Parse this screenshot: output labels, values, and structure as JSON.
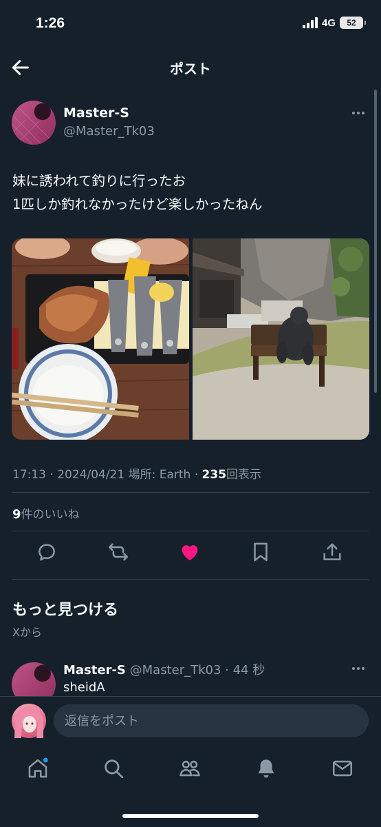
{
  "status_bar": {
    "time": "1:26",
    "network": "4G",
    "battery": "52"
  },
  "header": {
    "title": "ポスト",
    "back_icon": "arrow-left-icon"
  },
  "post": {
    "author_name": "Master-S",
    "author_handle": "@Master_Tk03",
    "text_lines": [
      "妹に誘われて釣りに行ったお",
      "1匹しか釣れなかったけど楽しかったねん"
    ],
    "meta": {
      "time_date": "17:13 · 2024/04/21",
      "location_label": "場所: Earth",
      "separator": "·",
      "views_count": "235",
      "views_label": "回表示"
    },
    "likes": {
      "count": "9",
      "label": "件のいいね"
    },
    "actions": [
      "reply-icon",
      "repost-icon",
      "heart-icon",
      "bookmark-icon",
      "share-icon"
    ],
    "like_color": "#f91880"
  },
  "discover": {
    "title": "もっと見つける",
    "subtitle": "Xから"
  },
  "reply_preview": {
    "name": "Master-S",
    "handle_time": "@Master_Tk03 · 44 秒",
    "text": "sheidA"
  },
  "compose": {
    "placeholder": "返信をポスト"
  },
  "bottom_nav": [
    "home-icon",
    "search-icon",
    "communities-icon",
    "notifications-icon",
    "messages-icon"
  ],
  "colors": {
    "background": "#15202b",
    "secondary_text": "#8b98a5",
    "accent": "#1d9bf0"
  }
}
